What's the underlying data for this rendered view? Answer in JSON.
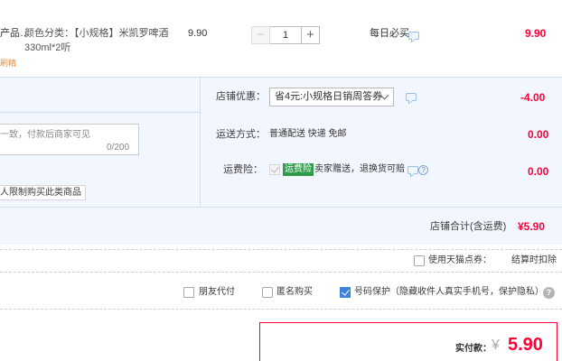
{
  "product": {
    "title_fragment": "产品…",
    "sku": "颜色分类：【小规格】米凯罗啤酒",
    "sku_spec": "330ml*2听",
    "sub_label": "刷精",
    "unit_price": "9.90",
    "quantity": "1",
    "minus_label": "−",
    "plus_label": "+",
    "promo_note": "每日必买",
    "subtotal": "9.90"
  },
  "shop": {
    "discount_label": "店铺优惠：",
    "discount_selected": "省4元:小规格日销周答券",
    "discount_amount": "-4.00",
    "message_placeholder": "一致，付款后商家可见",
    "message_counter": "0/200",
    "shipping_label": "运送方式：",
    "shipping_value": "普通配送 快递 免邮",
    "shipping_amount": "0.00",
    "insurance_label": "运费险：",
    "insurance_tag": "运费险",
    "insurance_text": "卖家赠送，退换货可赔",
    "insurance_amount": "0.00",
    "restriction_note": "人限制购买此类商品",
    "total_label": "店铺合计(含运费)",
    "total_value": "¥5.90"
  },
  "points": {
    "use_points_label": "使用天猫点券：",
    "points_status": "结算时扣除"
  },
  "options": {
    "friend_pay": "朋友代付",
    "anonymous": "匿名购买",
    "number_protect": "号码保护（隐藏收件人真实手机号，保护隐私）",
    "help_glyph": "?"
  },
  "payment": {
    "label": "实付款：",
    "currency": "¥",
    "amount": "5.90"
  },
  "colors": {
    "accent_red": "#ff0036",
    "panel_blue": "#f2f7ff",
    "checkbox_blue": "#3b82dc",
    "insurance_green": "#2f9c4b"
  }
}
